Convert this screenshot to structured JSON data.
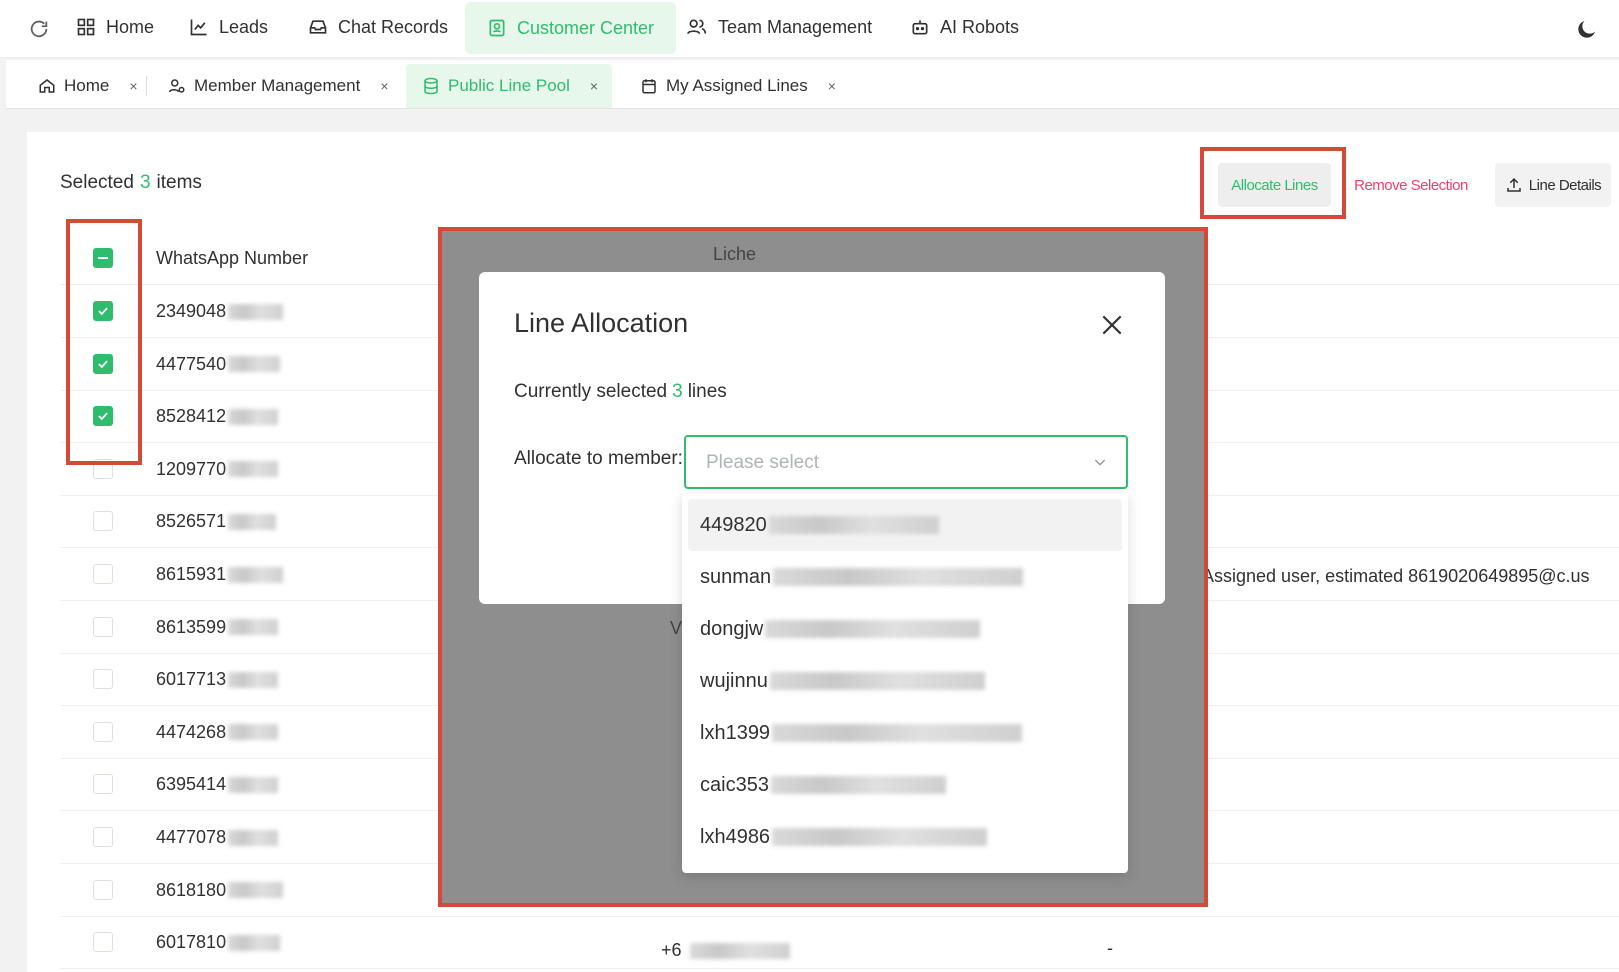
{
  "topnav": {
    "items": [
      {
        "label": "Home",
        "icon": "grid-icon"
      },
      {
        "label": "Leads",
        "icon": "chart-line-icon"
      },
      {
        "label": "Chat Records",
        "icon": "inbox-icon"
      },
      {
        "label": "Customer Center",
        "icon": "contact-card-icon",
        "active": true
      },
      {
        "label": "Team Management",
        "icon": "users-icon"
      },
      {
        "label": "AI Robots",
        "icon": "robot-icon"
      }
    ]
  },
  "tabs": [
    {
      "label": "Home",
      "icon": "house-icon",
      "close": "×"
    },
    {
      "label": "Member Management",
      "icon": "user-gear-icon",
      "close": "×"
    },
    {
      "label": "Public Line Pool",
      "icon": "database-icon",
      "close": "×",
      "active": true
    },
    {
      "label": "My Assigned Lines",
      "icon": "calendar-icon",
      "close": "×"
    }
  ],
  "toolbar": {
    "selected_prefix": "Selected",
    "selected_count": "3",
    "selected_suffix": "items",
    "allocate_label": "Allocate Lines",
    "remove_label": "Remove Selection",
    "details_label": "Line Details"
  },
  "table": {
    "col_number": "WhatsApp Number",
    "col_partial_header": "Liche",
    "rows": [
      {
        "number": "2349048",
        "checked": true
      },
      {
        "number": "4477540",
        "checked": true
      },
      {
        "number": "8528412",
        "checked": true
      },
      {
        "number": "1209770",
        "checked": false
      },
      {
        "number": "8526571",
        "checked": false
      },
      {
        "number": "8615931",
        "checked": false,
        "extra": "Assigned user, estimated 8619020649895@c.us"
      },
      {
        "number": "8613599",
        "checked": false,
        "partial": "V"
      },
      {
        "number": "6017713",
        "checked": false
      },
      {
        "number": "4474268",
        "checked": false
      },
      {
        "number": "6395414",
        "checked": false
      },
      {
        "number": "4477078",
        "checked": false
      },
      {
        "number": "8618180",
        "checked": false
      },
      {
        "number": "6017810",
        "checked": false,
        "mid": "+6",
        "dash": "-"
      }
    ]
  },
  "modal": {
    "title": "Line Allocation",
    "info_prefix": "Currently selected",
    "info_count": "3",
    "info_suffix": "lines",
    "label": "Allocate to member:",
    "placeholder": "Please select",
    "options": [
      "449820",
      "sunman",
      "dongjw",
      "wujinnu",
      "lxh1399",
      "caic353",
      "lxh4986"
    ]
  },
  "colors": {
    "accent": "#2fbd6d",
    "danger": "#f0406a",
    "highlight": "#d44a3a"
  }
}
